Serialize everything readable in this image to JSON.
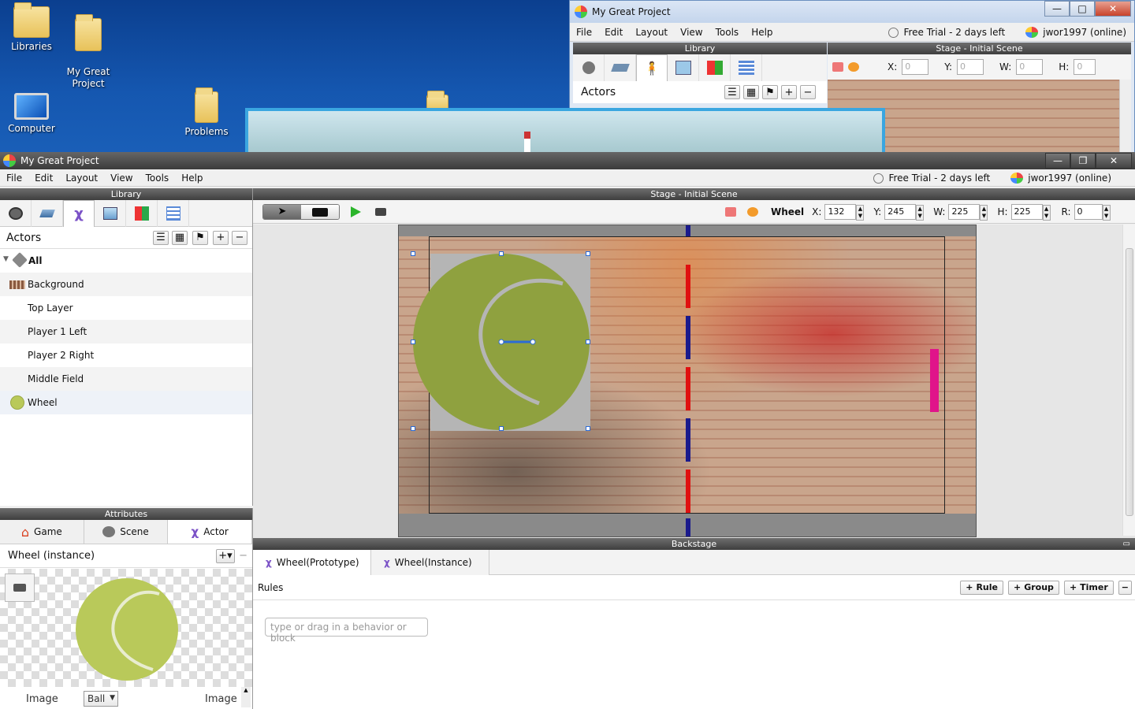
{
  "desktop": {
    "icons": [
      {
        "label": "Libraries"
      },
      {
        "label": "My Great\nProject"
      },
      {
        "label": "Computer"
      },
      {
        "label": "Problems"
      }
    ]
  },
  "back_window": {
    "title": "My Great Project",
    "menu": [
      "File",
      "Edit",
      "Layout",
      "View",
      "Tools",
      "Help"
    ],
    "trial": "Free Trial - 2 days left",
    "user": "jwor1997 (online)",
    "library_header": "Library",
    "stage_header": "Stage - Initial Scene",
    "actors_label": "Actors",
    "fields": {
      "x_label": "X:",
      "x": "0",
      "y_label": "Y:",
      "y": "0",
      "w_label": "W:",
      "w": "0",
      "h_label": "H:",
      "h": "0"
    }
  },
  "main_window": {
    "title": "My Great Project",
    "menu": [
      "File",
      "Edit",
      "Layout",
      "View",
      "Tools",
      "Help"
    ],
    "trial": "Free Trial - 2 days left",
    "user": "jwor1997 (online)"
  },
  "library": {
    "header": "Library",
    "actors_label": "Actors",
    "items": [
      {
        "label": "All"
      },
      {
        "label": "Background"
      },
      {
        "label": "Top Layer"
      },
      {
        "label": "Player 1 Left"
      },
      {
        "label": "Player 2 Right"
      },
      {
        "label": "Middle Field"
      },
      {
        "label": "Wheel"
      }
    ]
  },
  "attributes": {
    "header": "Attributes",
    "tabs": [
      "Game",
      "Scene",
      "Actor"
    ],
    "instance_title": "Wheel (instance)",
    "image_label_left": "Image",
    "image_select": "Ball",
    "image_label_right": "Image"
  },
  "stage": {
    "header": "Stage - Initial Scene",
    "selected_actor": "Wheel",
    "fields": {
      "x_label": "X:",
      "x": "132",
      "y_label": "Y:",
      "y": "245",
      "w_label": "W:",
      "w": "225",
      "h_label": "H:",
      "h": "225",
      "r_label": "R:",
      "r": "0"
    }
  },
  "backstage": {
    "header": "Backstage",
    "tabs": [
      "Wheel(Prototype)",
      "Wheel(Instance)"
    ],
    "rules_label": "Rules",
    "buttons": {
      "rule": "Rule",
      "group": "Group",
      "timer": "Timer"
    },
    "behavior_placeholder": "type or drag in a behavior or block"
  },
  "colors": {
    "ball": "#8fa13f",
    "ball_light": "#b9c95a",
    "center_line_blue": "#1a1a8c",
    "center_line_red": "#e01010",
    "paddle_pink": "#e0148a",
    "play_green": "#2bb52b"
  }
}
